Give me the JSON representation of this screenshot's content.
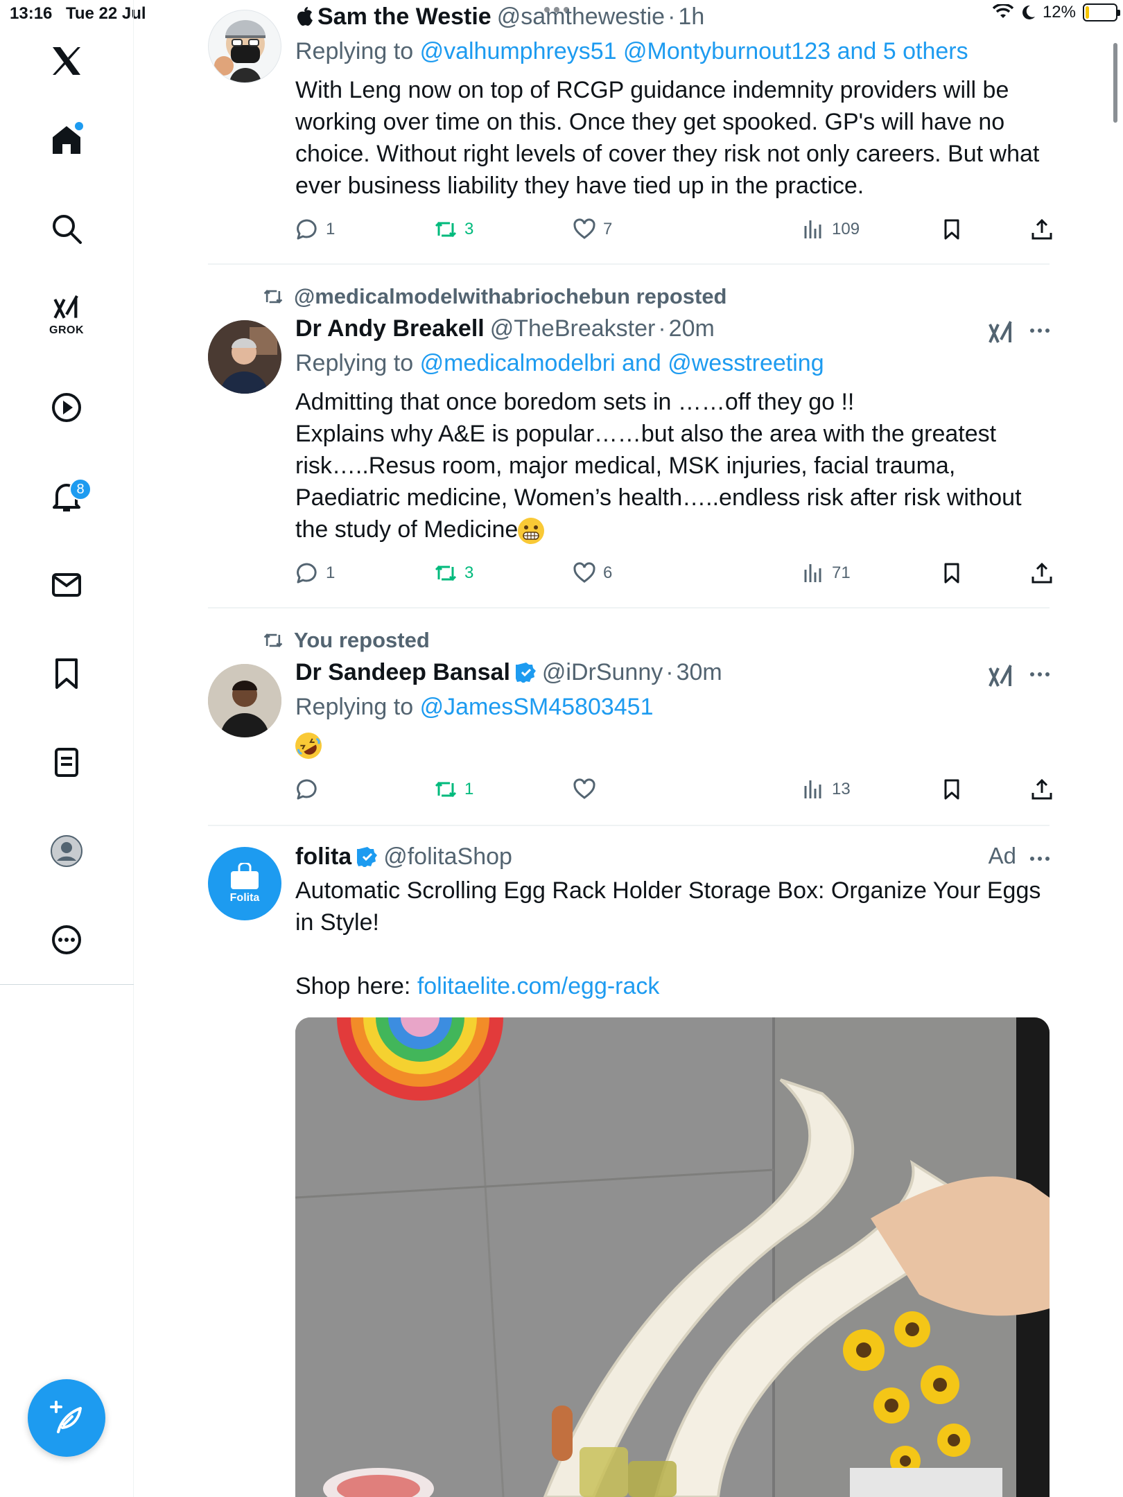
{
  "status_bar": {
    "time": "13:16",
    "date": "Tue 22 Jul",
    "battery": "12%",
    "battery_level": 0.12
  },
  "sidebar": {
    "notifications_badge": "8",
    "grok_label": "GROK"
  },
  "tweets": [
    {
      "name": "Sam the Westie",
      "handle": "@samthewestie",
      "time": "1h",
      "replying_prefix": "Replying to",
      "replying_to": "@valhumphreys51 @Montyburnout123 and 5 others",
      "text": "With Leng now on top of RCGP guidance indemnity providers will be working over time on this. Once they get spooked. GP's will have no choice. Without right levels of cover they risk not only careers. But what ever business liability they have tied up in the practice.",
      "replies": "1",
      "reposts": "3",
      "likes": "7",
      "views": "109"
    },
    {
      "reposted_by": "@medicalmodelwithabriochebun reposted",
      "name": "Dr Andy Breakell",
      "handle": "@TheBreakster",
      "time": "20m",
      "replying_prefix": "Replying to",
      "replying_to": "@medicalmodelbri and @wesstreeting",
      "text_lines": [
        "Admitting that once boredom sets in ……off they go !!",
        "Explains why A&E is popular……but also the area with the greatest risk…..Resus room, major medical, MSK injuries, facial trauma, Paediatric medicine, Women’s health…..endless risk after risk without the study of Medicine"
      ],
      "replies": "1",
      "reposts": "3",
      "likes": "6",
      "views": "71"
    },
    {
      "reposted_by": "You reposted",
      "name": "Dr Sandeep Bansal",
      "handle": "@iDrSunny",
      "time": "30m",
      "replying_prefix": "Replying to",
      "replying_to": "@JamesSM45803451",
      "reposts": "1",
      "views": "13"
    },
    {
      "name": "folita",
      "handle": "@folitaShop",
      "ad_label": "Ad",
      "avatar_text": "Folita",
      "text": "Automatic Scrolling Egg Rack Holder Storage Box: Organize Your Eggs in Style!",
      "shop_prefix": "Shop here:",
      "shop_link": "folitaelite.com/egg-rack"
    }
  ],
  "colors": {
    "accent": "#1d9bf0",
    "repost_green": "#00ba7c",
    "secondary_text": "#536471"
  }
}
